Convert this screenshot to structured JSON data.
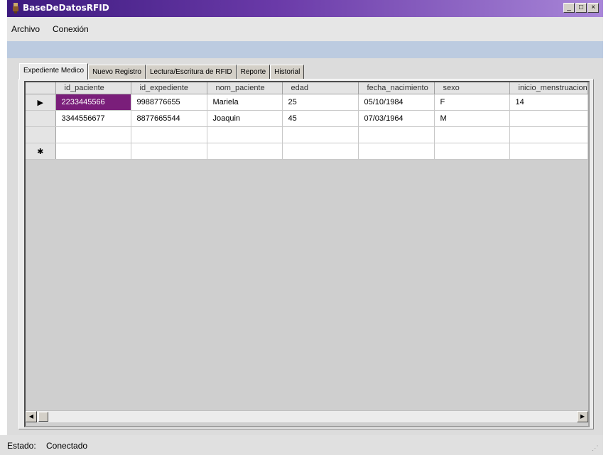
{
  "window": {
    "title": "BaseDeDatosRFID"
  },
  "menu": [
    "Archivo",
    "Conexión"
  ],
  "tabs": [
    {
      "label": "Expediente Medico",
      "active": true
    },
    {
      "label": "Nuevo Registro",
      "active": false
    },
    {
      "label": "Lectura/Escritura de RFID",
      "active": false
    },
    {
      "label": "Reporte",
      "active": false
    },
    {
      "label": "Historial",
      "active": false
    }
  ],
  "grid": {
    "columns": [
      "id_paciente",
      "id_expediente",
      "nom_paciente",
      "edad",
      "fecha_nacimiento",
      "sexo",
      "inicio_menstruacion"
    ],
    "rows": [
      {
        "indicator": "▶",
        "cells": [
          "2233445566",
          "9988776655",
          "Mariela",
          "25",
          "05/10/1984",
          "F",
          "14"
        ]
      },
      {
        "indicator": "",
        "cells": [
          "3344556677",
          "8877665544",
          "Joaquin",
          "45",
          "07/03/1964",
          "M",
          ""
        ]
      },
      {
        "indicator": "",
        "cells": [
          "",
          "",
          "",
          "",
          "",
          "",
          ""
        ]
      },
      {
        "indicator": "✱",
        "cells": [
          "",
          "",
          "",
          "",
          "",
          "",
          ""
        ]
      }
    ]
  },
  "status": {
    "label": "Estado:",
    "value": "Conectado"
  }
}
